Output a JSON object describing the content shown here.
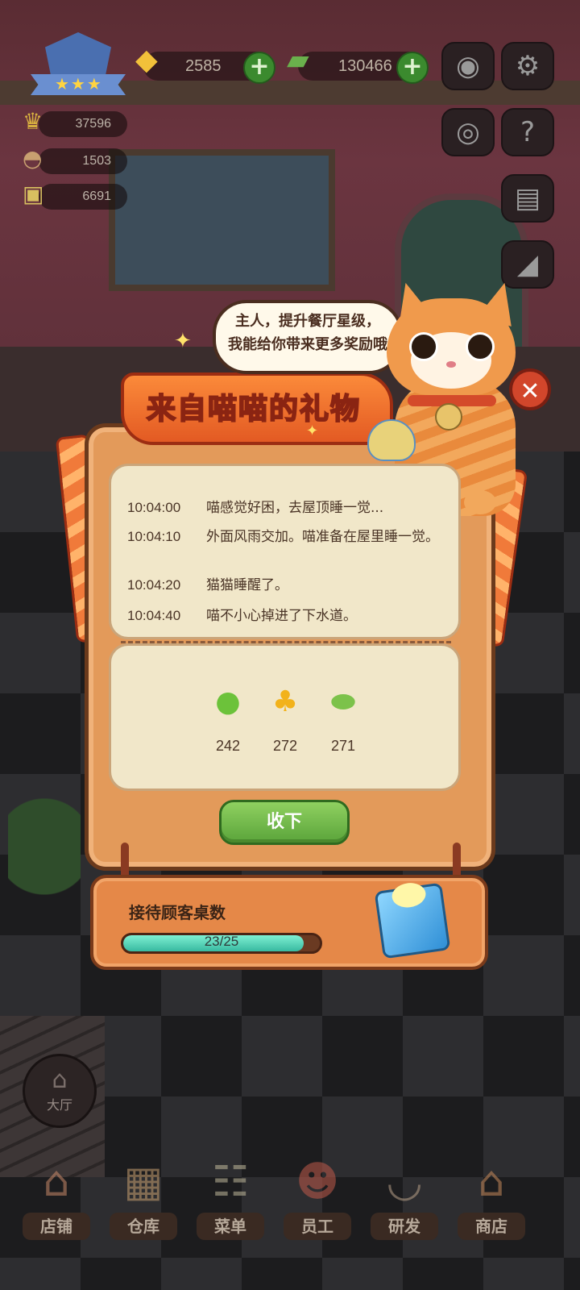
{
  "hud": {
    "gems": "2585",
    "cash": "130466",
    "stats": [
      "37596",
      "1503",
      "6691"
    ]
  },
  "speech": {
    "line1": "主人，提升餐厅星级，",
    "line2": "我能给你带来更多奖励哦"
  },
  "dialog": {
    "title": "来自喵喵的礼物",
    "logs": [
      {
        "time": "10:04:00",
        "text": "喵感觉好困，去屋顶睡一觉..."
      },
      {
        "time": "10:04:10",
        "text": "外面风雨交加。喵准备在屋里睡一觉。"
      },
      {
        "time": "10:04:20",
        "text": "猫猫睡醒了。"
      },
      {
        "time": "10:04:40",
        "text": "喵不小心掉进了下水道。"
      }
    ],
    "rewards": [
      {
        "icon": "lime-icon",
        "count": "242"
      },
      {
        "icon": "bell-pepper-icon",
        "count": "272"
      },
      {
        "icon": "bitter-melon-icon",
        "count": "271"
      }
    ],
    "accept_label": "收下"
  },
  "progress": {
    "label": "接待顾客桌数",
    "text": "23/25",
    "fraction": 0.92
  },
  "hall": {
    "label": "大厅"
  },
  "nav": {
    "items": [
      {
        "label": "店铺"
      },
      {
        "label": "仓库"
      },
      {
        "label": "菜单"
      },
      {
        "label": "员工"
      },
      {
        "label": "研发"
      },
      {
        "label": "商店"
      }
    ]
  },
  "colors": {
    "accent": "#5aa43a",
    "dialog": "#e39a5a",
    "close": "#d2462b"
  }
}
